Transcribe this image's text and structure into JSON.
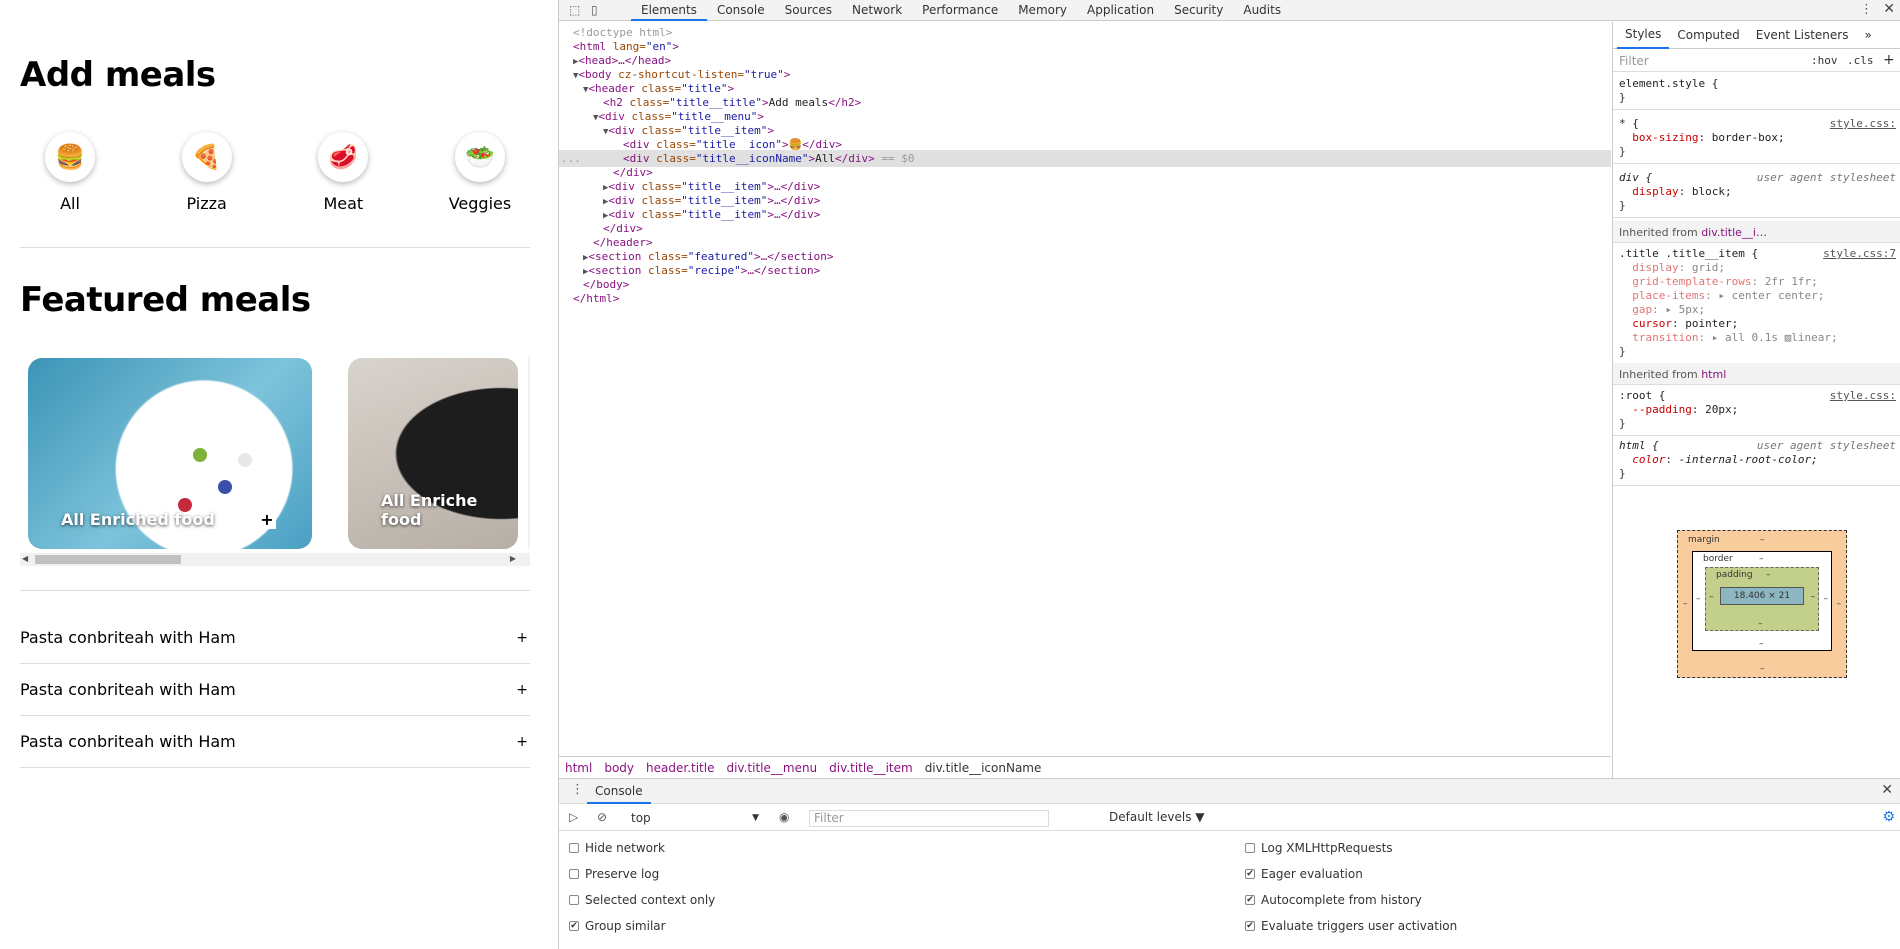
{
  "page": {
    "header_title": "Add meals",
    "menu": [
      {
        "icon": "burger-icon",
        "glyph": "🍔",
        "name": "All"
      },
      {
        "icon": "pizza-icon",
        "glyph": "🍕",
        "name": "Pizza"
      },
      {
        "icon": "meat-icon",
        "glyph": "🥩",
        "name": "Meat"
      },
      {
        "icon": "salad-icon",
        "glyph": "🥗",
        "name": "Veggies"
      }
    ],
    "featured_title": "Featured meals",
    "cards": [
      {
        "label": "All Enriched food",
        "plus": "+"
      },
      {
        "label": "All Enriche food"
      }
    ],
    "recipes": [
      {
        "name": "Pasta conbriteah with Ham",
        "plus": "+"
      },
      {
        "name": "Pasta conbriteah with Ham",
        "plus": "+"
      },
      {
        "name": "Pasta conbriteah with Ham",
        "plus": "+"
      }
    ]
  },
  "devtools": {
    "tabs": [
      "Elements",
      "Console",
      "Sources",
      "Network",
      "Performance",
      "Memory",
      "Application",
      "Security",
      "Audits"
    ],
    "active_tab": "Elements",
    "dom": {
      "l1": "<!doctype html>",
      "html_open_tag": "<html",
      "html_lang_attr": " lang=",
      "html_lang_val": "\"en\"",
      "html_close_br": ">",
      "head": "<head>…</head>",
      "body_open": "<body",
      "body_attr": " cz-shortcut-listen=",
      "body_val": "\"true\"",
      "body_close": ">",
      "header_open": "<header",
      "header_attr": " class=",
      "header_val": "\"title\"",
      "header_close": ">",
      "h2_open": "<h2",
      "h2_attr": " class=",
      "h2_val": "\"title__title\"",
      "h2_gt": ">",
      "h2_text": "Add meals",
      "h2_end": "</h2>",
      "menu_open": "<div",
      "menu_attr": " class=",
      "menu_val": "\"title__menu\"",
      "menu_gt": ">",
      "item_open": "<div",
      "item_attr": " class=",
      "item_val": "\"title__item\"",
      "item_gt": ">",
      "icon_open": "<div",
      "icon_attr": " class=",
      "icon_val": "\"title__icon\"",
      "icon_gt": ">",
      "icon_glyph": "🍔",
      "icon_end": "</div>",
      "name_open": "<div",
      "name_attr": " class=",
      "name_val": "\"title__iconName\"",
      "name_gt": ">",
      "name_text": "All",
      "name_end": "</div>",
      "eq": " == $0",
      "div_end": "</div>",
      "item_collapsed": "…</div>",
      "menu_end": "</div>",
      "header_end": "</header>",
      "sec1_open": "<section",
      "sec1_attr": " class=",
      "sec1_val": "\"featured\"",
      "sec1_rest": ">…</section>",
      "sec2_open": "<section",
      "sec2_attr": " class=",
      "sec2_val": "\"recipe\"",
      "sec2_rest": ">…</section>",
      "body_end": "</body>",
      "html_end": "</html>",
      "ellipsis": "..."
    },
    "breadcrumbs": [
      "html",
      "body",
      "header.title",
      "div.title__menu",
      "div.title__item",
      "div.title__iconName"
    ],
    "styles": {
      "tabs": [
        "Styles",
        "Computed",
        "Event Listeners"
      ],
      "more": "»",
      "filter_placeholder": "Filter",
      "hov": ":hov",
      "cls": ".cls",
      "plus": "+",
      "r1_sel": "element.style {",
      "close": "}",
      "r2_sel": "* {",
      "r2_src": "style.css:",
      "r2_prop": "box-sizing",
      "r2_val": "border-box;",
      "r3_sel": "div {",
      "r3_src": "user agent stylesheet",
      "r3_prop": "display",
      "r3_val": "block;",
      "inh1_label": "Inherited from ",
      "inh1_link": "div.title__i…",
      "r4_sel": ".title .title__item {",
      "r4_src": "style.css:7",
      "r4_props": [
        {
          "p": "display",
          "v": "grid;"
        },
        {
          "p": "grid-template-rows",
          "v": "2fr 1fr;"
        },
        {
          "p": "place-items",
          "v": "▸ center center;"
        },
        {
          "p": "gap",
          "v": "▸ 5px;"
        },
        {
          "p": "cursor",
          "v": "pointer;"
        },
        {
          "p": "transition",
          "v": "▸ all 0.1s ▨linear;"
        }
      ],
      "inh2_label": "Inherited from ",
      "inh2_link": "html",
      "r5_sel": ":root {",
      "r5_src": "style.css:",
      "r5_prop": "--padding",
      "r5_val": "20px;",
      "r6_sel": "html {",
      "r6_src": "user agent stylesheet",
      "r6_prop": "color",
      "r6_val": "-internal-root-color;",
      "box": {
        "margin": "margin",
        "border": "border",
        "padding": "padding",
        "dash": "–",
        "content": "18.406 × 21"
      }
    },
    "console": {
      "title": "Console",
      "context": "top",
      "filter_placeholder": "Filter",
      "levels": "Default levels ▼",
      "options_left": [
        {
          "label": "Hide network",
          "checked": false
        },
        {
          "label": "Preserve log",
          "checked": false
        },
        {
          "label": "Selected context only",
          "checked": false
        },
        {
          "label": "Group similar",
          "checked": true
        }
      ],
      "options_right": [
        {
          "label": "Log XMLHttpRequests",
          "checked": false
        },
        {
          "label": "Eager evaluation",
          "checked": true
        },
        {
          "label": "Autocomplete from history",
          "checked": true
        },
        {
          "label": "Evaluate triggers user activation",
          "checked": true
        }
      ]
    }
  }
}
